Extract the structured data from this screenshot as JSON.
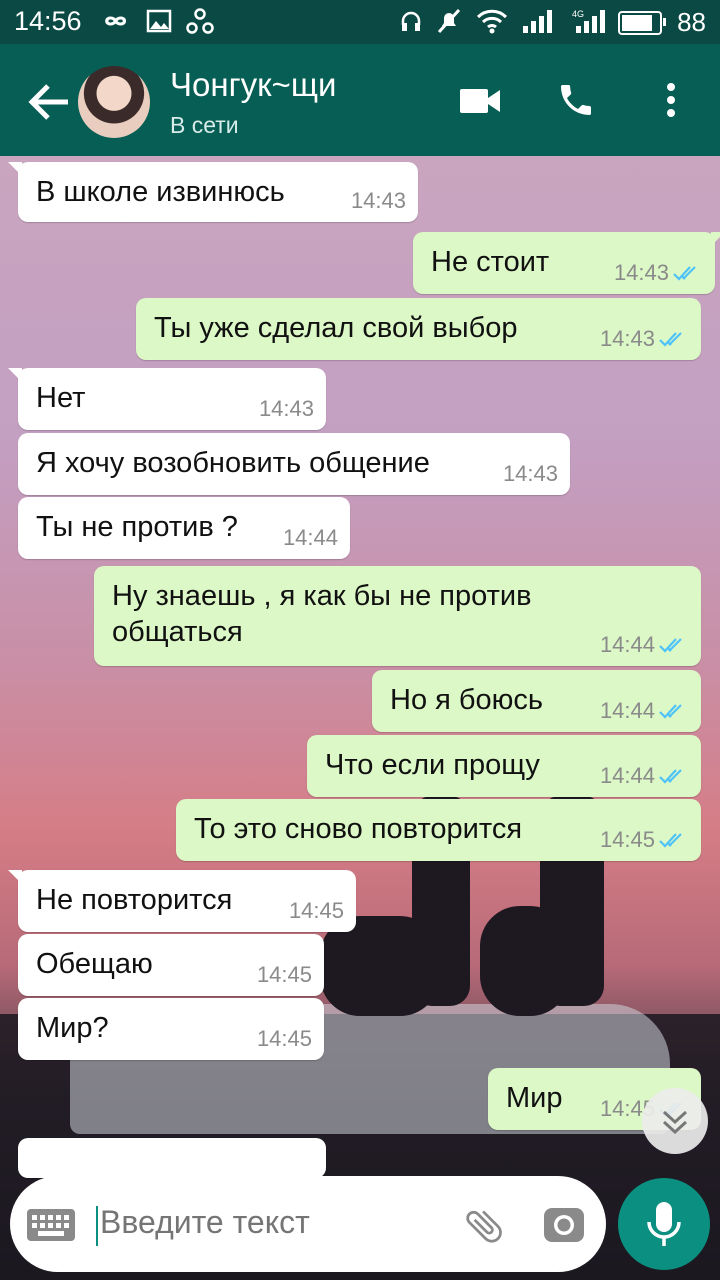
{
  "status_bar": {
    "time": "14:56",
    "battery": "88",
    "battery_level": 0.88
  },
  "contact": {
    "name": "Чонгук~щи",
    "status": "В сети"
  },
  "messages": [
    {
      "dir": "in",
      "text": "В школе извинюсь",
      "time": "14:43"
    },
    {
      "dir": "out",
      "text": "Не стоит",
      "time": "14:43"
    },
    {
      "dir": "out",
      "text": "Ты уже сделал свой выбор",
      "time": "14:43"
    },
    {
      "dir": "in",
      "text": "Нет",
      "time": "14:43"
    },
    {
      "dir": "in",
      "text": "Я хочу возобновить общение",
      "time": "14:43"
    },
    {
      "dir": "in",
      "text": "Ты не против ?",
      "time": "14:44"
    },
    {
      "dir": "out",
      "text": "Ну знаешь , я как бы не против\nобщаться",
      "time": "14:44"
    },
    {
      "dir": "out",
      "text": "Но я боюсь",
      "time": "14:44"
    },
    {
      "dir": "out",
      "text": "Что если прощу",
      "time": "14:44"
    },
    {
      "dir": "out",
      "text": "То это сново повторится",
      "time": "14:45"
    },
    {
      "dir": "in",
      "text": "Не повторится",
      "time": "14:45"
    },
    {
      "dir": "in",
      "text": "Обещаю",
      "time": "14:45"
    },
    {
      "dir": "in",
      "text": "Мир?",
      "time": "14:45"
    },
    {
      "dir": "out",
      "text": "Мир",
      "time": "14:45"
    }
  ],
  "input": {
    "placeholder": "Введите текст"
  },
  "icons": {
    "back": "arrow-back-icon",
    "video": "video-call-icon",
    "call": "phone-icon",
    "menu": "more-vert-icon",
    "keyboard": "keyboard-icon",
    "attach": "paperclip-icon",
    "camera": "camera-icon",
    "mic": "microphone-icon",
    "scroll": "chevron-double-down-icon",
    "read": "double-check-icon"
  },
  "colors": {
    "header": "#075e54",
    "status_bar": "#0b4a44",
    "incoming": "#ffffff",
    "outgoing": "#dcf8c6",
    "accent": "#0b8f80",
    "read_ticks": "#4fc3f7"
  }
}
